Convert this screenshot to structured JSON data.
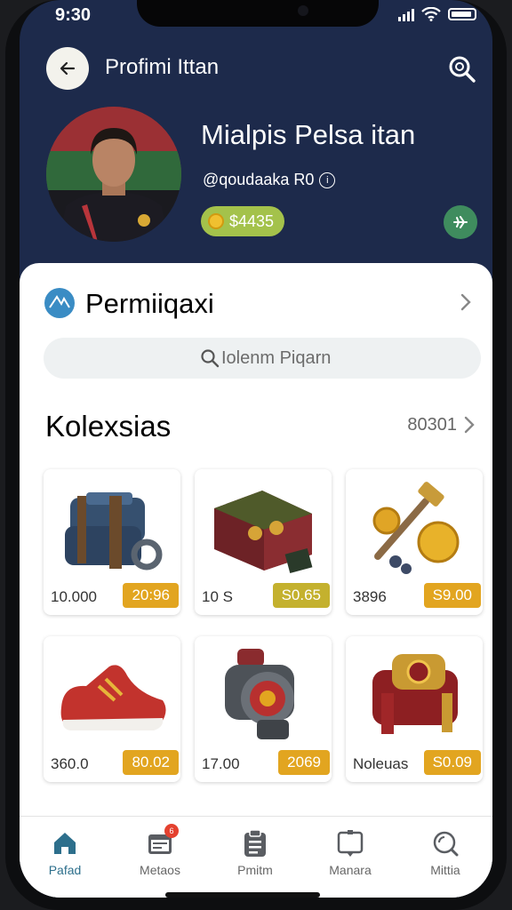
{
  "status_bar": {
    "time": "9:30"
  },
  "header": {
    "title": "Profimi Ittan"
  },
  "profile": {
    "name": "Mialpis Pelsa itan",
    "handle": "@qoudaaka R0",
    "balance": "$4435"
  },
  "section": {
    "title": "Permiiqaxi"
  },
  "search": {
    "placeholder": "Iolenm Piqarn"
  },
  "collection": {
    "title": "Kolexsias",
    "count": "80301",
    "items": [
      {
        "qty": "10.000",
        "price": "20:96",
        "price_color": "#e2a520",
        "icon": "backpack"
      },
      {
        "qty": "10 S",
        "price": "S0.65",
        "price_color": "#c4b12e",
        "icon": "chest"
      },
      {
        "qty": "3896",
        "price": "S9.00",
        "price_color": "#e2a520",
        "icon": "coins-hammer"
      },
      {
        "qty": "360.0",
        "price": "80.02",
        "price_color": "#e2a520",
        "icon": "sneaker"
      },
      {
        "qty": "17.00",
        "price": "2069",
        "price_color": "#e2a520",
        "icon": "watch"
      },
      {
        "qty": "Noleuas",
        "price": "S0.09",
        "price_color": "#e2a520",
        "icon": "bracer"
      }
    ]
  },
  "tabbar": {
    "items": [
      {
        "label": "Pafad",
        "icon": "home-icon",
        "active": true
      },
      {
        "label": "Metaos",
        "icon": "calendar-icon",
        "badge": "6"
      },
      {
        "label": "Pmitm",
        "icon": "clipboard-icon"
      },
      {
        "label": "Manara",
        "icon": "message-icon"
      },
      {
        "label": "Mittia",
        "icon": "search-icon"
      }
    ]
  },
  "colors": {
    "header_bg": "#1d2a4b",
    "balance_bg": "#a4c24b",
    "price_gold": "#e2a520",
    "active_tab": "#2d6f8c"
  }
}
